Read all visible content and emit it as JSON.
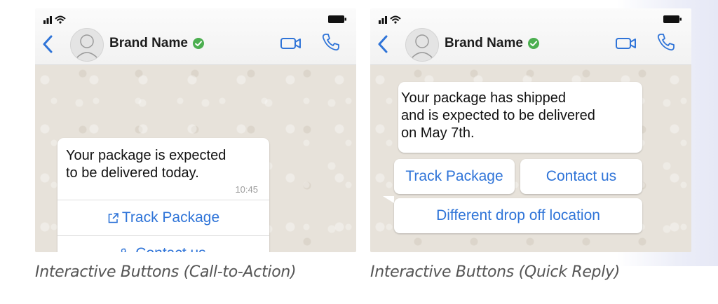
{
  "colors": {
    "accent_blue": "#2f74d8",
    "verified_green": "#4caf50",
    "chat_bg": "#e7e2da",
    "bubble": "#ffffff"
  },
  "left": {
    "brand_name": "Brand Name",
    "message": "Your package is expected\nto be delivered today.",
    "time": "10:45",
    "buttons": [
      {
        "label": "Track Package",
        "icon": "external-link-icon"
      },
      {
        "label": "Contact us",
        "icon": "phone-icon"
      }
    ],
    "caption": "Interactive Buttons (Call-to-Action)"
  },
  "right": {
    "brand_name": "Brand Name",
    "message": "Your package has shipped\nand is expected to be delivered\non May 7th.",
    "buttons": [
      {
        "label": "Track Package"
      },
      {
        "label": "Contact us"
      },
      {
        "label": "Different drop off location"
      }
    ],
    "caption": "Interactive Buttons (Quick Reply)"
  },
  "header_icons": [
    "back-arrow-icon",
    "avatar",
    "verified-icon",
    "video-call-icon",
    "voice-call-icon",
    "signal-icon",
    "wifi-icon",
    "battery-icon"
  ]
}
